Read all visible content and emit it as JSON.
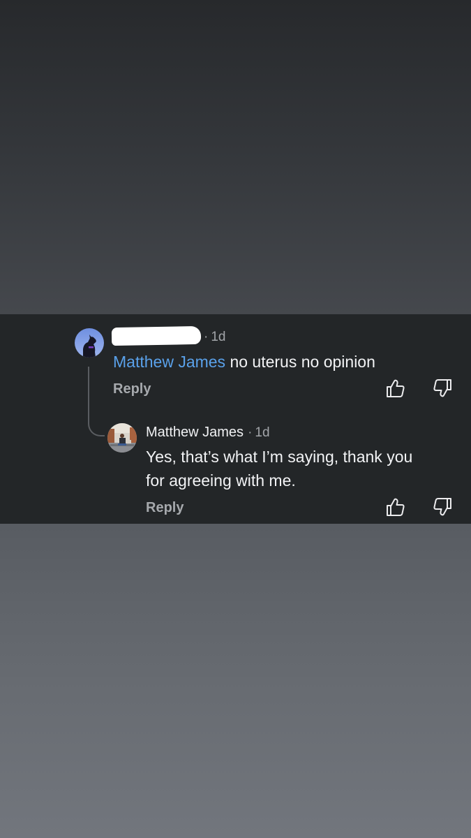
{
  "comments": [
    {
      "author": "",
      "author_redacted": true,
      "time_sep": "·",
      "time": "1d",
      "mention": "Matthew James",
      "text": " no uterus no opinion",
      "reply_label": "Reply"
    },
    {
      "author": "Matthew James",
      "time_sep": "·",
      "time": "1d",
      "text_line1": "Yes, that’s what I’m saying, thank you",
      "text_line2": "for agreeing with me.",
      "reply_label": "Reply"
    }
  ],
  "colors": {
    "mention": "#5aa1ea",
    "panel": "#232628",
    "secondary_text": "#a6a9ad"
  },
  "icons": [
    "thumbs-up-icon",
    "thumbs-down-icon"
  ]
}
